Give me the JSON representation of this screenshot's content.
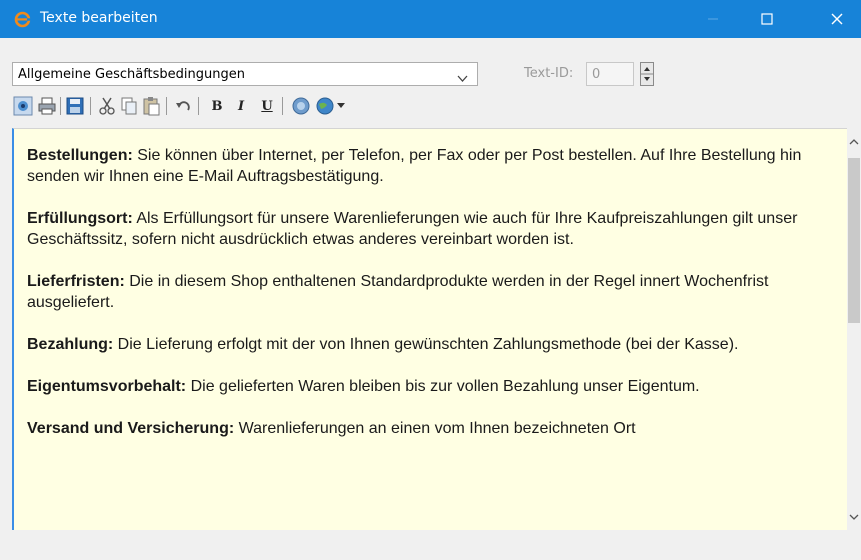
{
  "window": {
    "title": "Texte bearbeiten",
    "colors": {
      "titlebar": "#1783d8",
      "editor_bg": "#ffffe3",
      "logo": "#f08a1c"
    }
  },
  "selector": {
    "selected": "Allgemeine Geschäftsbedingungen",
    "text_id_label": "Text-ID:",
    "text_id_value": "0"
  },
  "toolbar": {
    "items": [
      "preview-icon",
      "print-icon",
      "save-icon",
      "cut-icon",
      "copy-icon",
      "paste-icon",
      "undo-icon",
      "bold-button",
      "italic-button",
      "underline-button",
      "insert-link-icon",
      "web-icon"
    ],
    "bold_label": "B",
    "italic_label": "I",
    "underline_label": "U"
  },
  "editor": {
    "paragraphs": [
      {
        "heading": "Bestellungen:",
        "text": " Sie können über Internet, per Telefon, per Fax oder per Post bestellen. Auf Ihre Bestellung hin senden wir Ihnen eine E-Mail Auftragsbestätigung."
      },
      {
        "heading": "Erfüllungsort:",
        "text": " Als Erfüllungsort für unsere Warenlieferungen wie auch für Ihre Kaufpreiszahlungen gilt unser Geschäftssitz, sofern nicht ausdrücklich etwas anderes vereinbart worden ist."
      },
      {
        "heading": "Lieferfristen:",
        "text": " Die in diesem Shop enthaltenen Standardprodukte werden in der Regel innert Wochenfrist ausgeliefert."
      },
      {
        "heading": "Bezahlung:",
        "text": " Die Lieferung erfolgt mit der von Ihnen gewünschten Zahlungsmethode (bei der Kasse)."
      },
      {
        "heading": "Eigentumsvorbehalt:",
        "text": " Die gelieferten Waren bleiben bis zur vollen Bezahlung unser Eigentum."
      },
      {
        "heading": "Versand und Versicherung:",
        "text": " Warenlieferungen an einen vom Ihnen bezeichneten Ort"
      }
    ]
  }
}
